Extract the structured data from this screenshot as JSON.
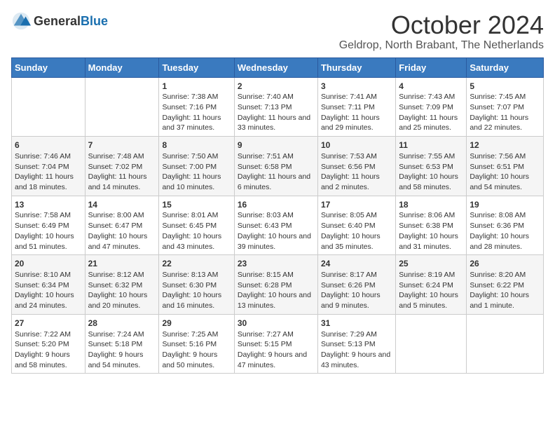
{
  "header": {
    "logo_general": "General",
    "logo_blue": "Blue",
    "title": "October 2024",
    "subtitle": "Geldrop, North Brabant, The Netherlands"
  },
  "weekdays": [
    "Sunday",
    "Monday",
    "Tuesday",
    "Wednesday",
    "Thursday",
    "Friday",
    "Saturday"
  ],
  "weeks": [
    [
      {
        "day": "",
        "info": ""
      },
      {
        "day": "",
        "info": ""
      },
      {
        "day": "1",
        "info": "Sunrise: 7:38 AM\nSunset: 7:16 PM\nDaylight: 11 hours and 37 minutes."
      },
      {
        "day": "2",
        "info": "Sunrise: 7:40 AM\nSunset: 7:13 PM\nDaylight: 11 hours and 33 minutes."
      },
      {
        "day": "3",
        "info": "Sunrise: 7:41 AM\nSunset: 7:11 PM\nDaylight: 11 hours and 29 minutes."
      },
      {
        "day": "4",
        "info": "Sunrise: 7:43 AM\nSunset: 7:09 PM\nDaylight: 11 hours and 25 minutes."
      },
      {
        "day": "5",
        "info": "Sunrise: 7:45 AM\nSunset: 7:07 PM\nDaylight: 11 hours and 22 minutes."
      }
    ],
    [
      {
        "day": "6",
        "info": "Sunrise: 7:46 AM\nSunset: 7:04 PM\nDaylight: 11 hours and 18 minutes."
      },
      {
        "day": "7",
        "info": "Sunrise: 7:48 AM\nSunset: 7:02 PM\nDaylight: 11 hours and 14 minutes."
      },
      {
        "day": "8",
        "info": "Sunrise: 7:50 AM\nSunset: 7:00 PM\nDaylight: 11 hours and 10 minutes."
      },
      {
        "day": "9",
        "info": "Sunrise: 7:51 AM\nSunset: 6:58 PM\nDaylight: 11 hours and 6 minutes."
      },
      {
        "day": "10",
        "info": "Sunrise: 7:53 AM\nSunset: 6:56 PM\nDaylight: 11 hours and 2 minutes."
      },
      {
        "day": "11",
        "info": "Sunrise: 7:55 AM\nSunset: 6:53 PM\nDaylight: 10 hours and 58 minutes."
      },
      {
        "day": "12",
        "info": "Sunrise: 7:56 AM\nSunset: 6:51 PM\nDaylight: 10 hours and 54 minutes."
      }
    ],
    [
      {
        "day": "13",
        "info": "Sunrise: 7:58 AM\nSunset: 6:49 PM\nDaylight: 10 hours and 51 minutes."
      },
      {
        "day": "14",
        "info": "Sunrise: 8:00 AM\nSunset: 6:47 PM\nDaylight: 10 hours and 47 minutes."
      },
      {
        "day": "15",
        "info": "Sunrise: 8:01 AM\nSunset: 6:45 PM\nDaylight: 10 hours and 43 minutes."
      },
      {
        "day": "16",
        "info": "Sunrise: 8:03 AM\nSunset: 6:43 PM\nDaylight: 10 hours and 39 minutes."
      },
      {
        "day": "17",
        "info": "Sunrise: 8:05 AM\nSunset: 6:40 PM\nDaylight: 10 hours and 35 minutes."
      },
      {
        "day": "18",
        "info": "Sunrise: 8:06 AM\nSunset: 6:38 PM\nDaylight: 10 hours and 31 minutes."
      },
      {
        "day": "19",
        "info": "Sunrise: 8:08 AM\nSunset: 6:36 PM\nDaylight: 10 hours and 28 minutes."
      }
    ],
    [
      {
        "day": "20",
        "info": "Sunrise: 8:10 AM\nSunset: 6:34 PM\nDaylight: 10 hours and 24 minutes."
      },
      {
        "day": "21",
        "info": "Sunrise: 8:12 AM\nSunset: 6:32 PM\nDaylight: 10 hours and 20 minutes."
      },
      {
        "day": "22",
        "info": "Sunrise: 8:13 AM\nSunset: 6:30 PM\nDaylight: 10 hours and 16 minutes."
      },
      {
        "day": "23",
        "info": "Sunrise: 8:15 AM\nSunset: 6:28 PM\nDaylight: 10 hours and 13 minutes."
      },
      {
        "day": "24",
        "info": "Sunrise: 8:17 AM\nSunset: 6:26 PM\nDaylight: 10 hours and 9 minutes."
      },
      {
        "day": "25",
        "info": "Sunrise: 8:19 AM\nSunset: 6:24 PM\nDaylight: 10 hours and 5 minutes."
      },
      {
        "day": "26",
        "info": "Sunrise: 8:20 AM\nSunset: 6:22 PM\nDaylight: 10 hours and 1 minute."
      }
    ],
    [
      {
        "day": "27",
        "info": "Sunrise: 7:22 AM\nSunset: 5:20 PM\nDaylight: 9 hours and 58 minutes."
      },
      {
        "day": "28",
        "info": "Sunrise: 7:24 AM\nSunset: 5:18 PM\nDaylight: 9 hours and 54 minutes."
      },
      {
        "day": "29",
        "info": "Sunrise: 7:25 AM\nSunset: 5:16 PM\nDaylight: 9 hours and 50 minutes."
      },
      {
        "day": "30",
        "info": "Sunrise: 7:27 AM\nSunset: 5:15 PM\nDaylight: 9 hours and 47 minutes."
      },
      {
        "day": "31",
        "info": "Sunrise: 7:29 AM\nSunset: 5:13 PM\nDaylight: 9 hours and 43 minutes."
      },
      {
        "day": "",
        "info": ""
      },
      {
        "day": "",
        "info": ""
      }
    ]
  ]
}
